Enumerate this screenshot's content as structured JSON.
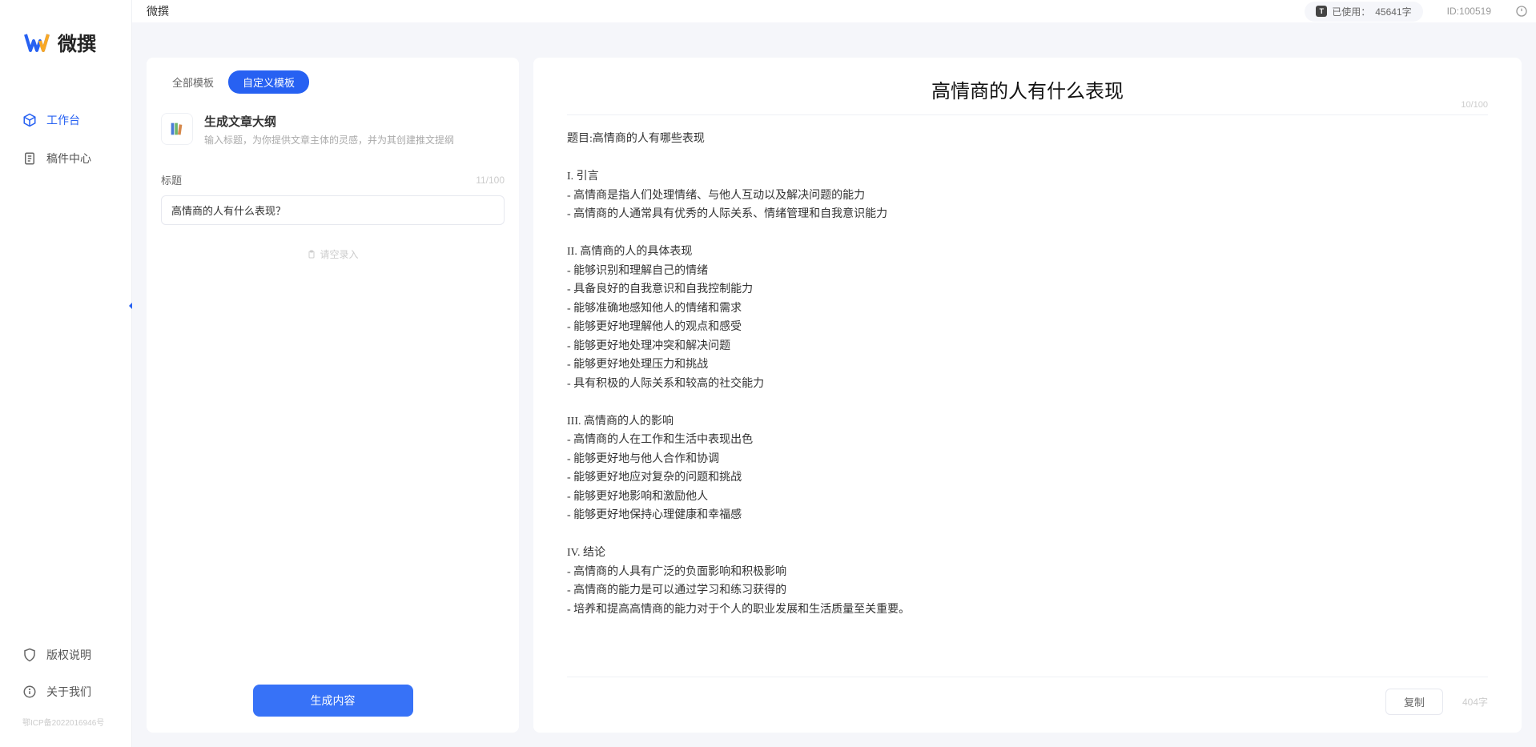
{
  "brand": {
    "name": "微撰"
  },
  "header": {
    "title": "微撰",
    "usage_label": "已使用：",
    "usage_value": "45641字",
    "usage_icon_letter": "T",
    "id_label": "ID:100519"
  },
  "sidebar": {
    "nav": [
      {
        "label": "工作台",
        "icon": "cube",
        "active": true
      },
      {
        "label": "稿件中心",
        "icon": "document",
        "active": false
      }
    ],
    "bottom": [
      {
        "label": "版权说明",
        "icon": "shield"
      },
      {
        "label": "关于我们",
        "icon": "info"
      }
    ],
    "icp": "鄂ICP备2022016946号"
  },
  "left": {
    "tabs": [
      {
        "label": "全部模板",
        "active": false
      },
      {
        "label": "自定义模板",
        "active": true
      }
    ],
    "template": {
      "title": "生成文章大纲",
      "desc": "输入标题，为你提供文章主体的灵感，并为其创建推文提纲"
    },
    "field": {
      "label": "标题",
      "count": "11/100",
      "value": "高情商的人有什么表现？"
    },
    "tip": "请空录入",
    "generate": "生成内容"
  },
  "output": {
    "title": "高情商的人有什么表现",
    "title_count": "10/100",
    "body": "题目:高情商的人有哪些表现\n\nI. 引言\n- 高情商是指人们处理情绪、与他人互动以及解决问题的能力\n- 高情商的人通常具有优秀的人际关系、情绪管理和自我意识能力\n\nII. 高情商的人的具体表现\n- 能够识别和理解自己的情绪\n- 具备良好的自我意识和自我控制能力\n- 能够准确地感知他人的情绪和需求\n- 能够更好地理解他人的观点和感受\n- 能够更好地处理冲突和解决问题\n- 能够更好地处理压力和挑战\n- 具有积极的人际关系和较高的社交能力\n\nIII. 高情商的人的影响\n- 高情商的人在工作和生活中表现出色\n- 能够更好地与他人合作和协调\n- 能够更好地应对复杂的问题和挑战\n- 能够更好地影响和激励他人\n- 能够更好地保持心理健康和幸福感\n\nIV. 结论\n- 高情商的人具有广泛的负面影响和积极影响\n- 高情商的能力是可以通过学习和练习获得的\n- 培养和提高高情商的能力对于个人的职业发展和生活质量至关重要。",
    "copy": "复制",
    "word_count": "404字"
  }
}
